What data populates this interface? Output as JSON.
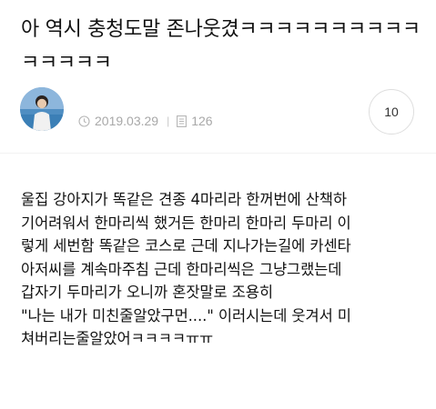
{
  "post": {
    "title": "아 역시 충청도말 존나웃겼ㅋㅋㅋㅋㅋㅋㅋㅋㅋㅋㅋㅋㅋㅋㅋ",
    "date": "2019.03.29",
    "views": "126",
    "comment_count": "10",
    "body_lines": [
      "울집 강아지가 똑같은 견종 4마리라 한꺼번에 산책하",
      "기어려워서 한마리씩 했거든 한마리 한마리 두마리 이",
      "렇게 세번함 똑같은 코스로 근데 지나가는길에 카센타",
      "아저씨를 계속마주침 근데 한마리씩은 그냥그랬는데",
      "갑자기 두마리가 오니까 혼잣말로 조용히",
      "\"나는 내가 미친줄알았구먼....\" 이러시는데 웃겨서 미",
      "쳐버리는줄알았어ㅋㅋㅋㅋㅠㅠ"
    ]
  },
  "icons": {
    "date": "clock-icon",
    "views": "document-icon"
  }
}
